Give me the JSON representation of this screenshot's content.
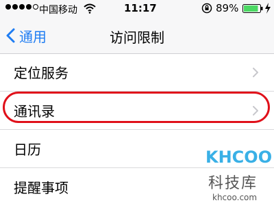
{
  "status_bar": {
    "signal_filled": 4,
    "signal_total": 5,
    "carrier": "中国移动",
    "time": "11:17",
    "battery_percent": "89%",
    "battery_level": 0.89
  },
  "nav": {
    "back_label": "通用",
    "title": "访问限制"
  },
  "list": {
    "items": [
      {
        "label": "定位服务"
      },
      {
        "label": "通讯录"
      },
      {
        "label": "日历"
      },
      {
        "label": "提醒事项"
      }
    ]
  },
  "watermark": {
    "brand": "KHCOO",
    "cn": "科技库",
    "url": "khcoo.com"
  },
  "colors": {
    "accent": "#1e7cf2",
    "highlight": "#e0101a",
    "battery_green": "#4cd964",
    "watermark_blue": "#39b0e6"
  },
  "icons": {
    "back": "chevron-left-icon",
    "row": "chevron-right-icon",
    "wifi": "wifi-icon",
    "rotation_lock": "rotation-lock-icon",
    "battery": "battery-icon",
    "charge": "charging-bolt-icon"
  }
}
